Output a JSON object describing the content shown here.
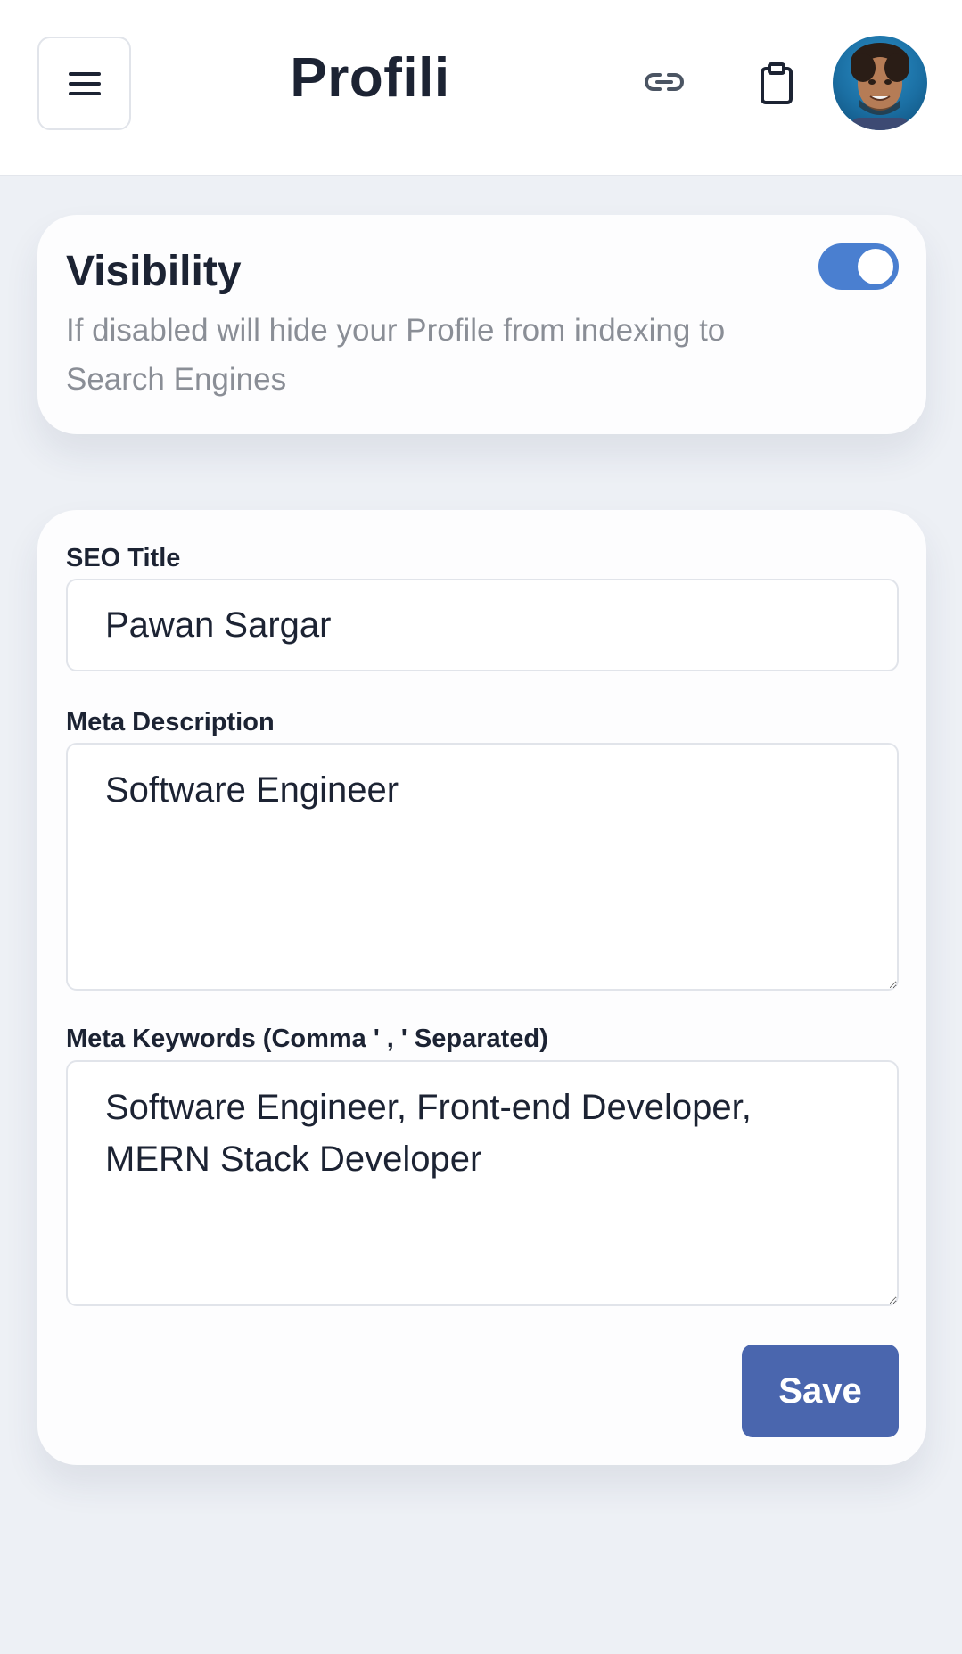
{
  "header": {
    "title": "Profili",
    "menu_icon": "hamburger-menu-icon",
    "link_icon": "link-icon",
    "clipboard_icon": "clipboard-icon",
    "avatar_alt": "user-avatar"
  },
  "visibility": {
    "title": "Visibility",
    "description": "If disabled will hide your Profile from indexing to Search Engines",
    "enabled": true,
    "toggle_color": "#4a7fd0"
  },
  "seo": {
    "title_label": "SEO Title",
    "title_value": "Pawan Sargar",
    "description_label": "Meta Description",
    "description_value": "Software Engineer",
    "keywords_label": "Meta Keywords (Comma ' , ' Separated)",
    "keywords_value": "Software Engineer, Front-end Developer, MERN Stack Developer",
    "save_label": "Save",
    "save_color": "#4a66ae"
  }
}
